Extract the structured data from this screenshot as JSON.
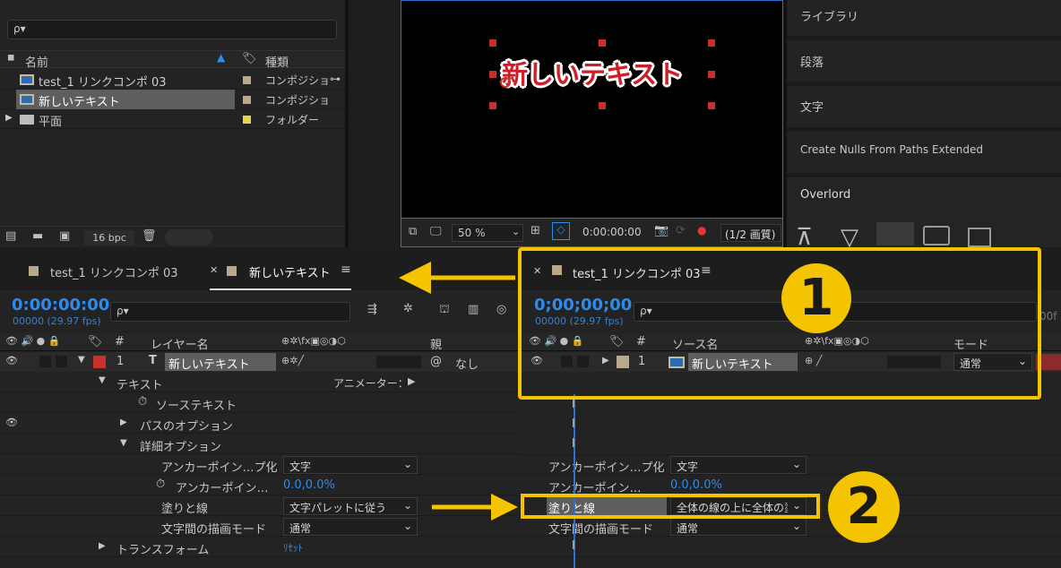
{
  "project": {
    "search_placeholder": "ρ▾",
    "col_name": "名前",
    "col_type": "種類",
    "items": [
      {
        "name": "test_1 リンクコンポ 03",
        "type": "コンポジショ",
        "label_color": "#b9a88a"
      },
      {
        "name": "新しいテキスト",
        "type": "コンポジショ",
        "label_color": "#b9a88a"
      },
      {
        "name": "平面",
        "type": "フォルダー",
        "label_color": "#e6d551"
      }
    ],
    "bpc": "16 bpc"
  },
  "viewer": {
    "text": "新しいテキスト",
    "zoom": "50 %",
    "timecode": "0:00:00:00",
    "resolution": "(1/2 画質)"
  },
  "right_panels": [
    "ライブラリ",
    "段落",
    "文字",
    "Create Nulls From Paths Extended",
    "Overlord"
  ],
  "left_timeline": {
    "tab_inactive": "test_1 リンクコンポ 03",
    "tab_active": "新しいテキスト",
    "timecode": "0:00:00:00",
    "fps": "00000 (29.97 fps)",
    "col_layer_name": "レイヤー名",
    "col_parent": "親",
    "col_switch_icons": "⊕✲\\fx▣◎◑⬡",
    "layer_num": "1",
    "layer_type": "T",
    "layer_name": "新しいテキスト",
    "parent_value": "なし",
    "tree": {
      "text": "テキスト",
      "animator": "アニメーター：",
      "source_text": "ソーステキスト",
      "path_options": "パスのオプション",
      "more_options": "詳細オプション",
      "anchor_group": "アンカーポイン…プ化",
      "anchor_group_value": "文字",
      "anchor_align": "アンカーポイン…",
      "anchor_align_value": "0.0,0.0%",
      "fill_stroke": "塗りと線",
      "fill_stroke_value": "文字パレットに従う",
      "blend": "文字間の描画モード",
      "blend_value": "通常",
      "transform": "トランスフォーム",
      "reset": "ﾘｾｯﾄ"
    }
  },
  "right_timeline": {
    "tab": "test_1 リンクコンポ 03",
    "timecode": "0;00;00;00",
    "fps": "00000 (29.97 fps)",
    "col_source": "ソース名",
    "col_mode": "モード",
    "layer_num": "1",
    "layer_name": "新しいテキスト",
    "mode_value": "通常",
    "anchor_group": "アンカーポイン…プ化",
    "anchor_group_value": "文字",
    "anchor_align": "アンカーポイン…",
    "anchor_align_value": "0.0,0.0%",
    "fill_stroke": "塗りと線",
    "fill_stroke_value": "全体の線の上に全体の塗り",
    "blend": "文字間の描画モード",
    "blend_value": "通常",
    "ruler_tail": "00f"
  },
  "callouts": {
    "one": "1",
    "two": "2"
  },
  "colors": {
    "accent_yellow": "#f5c400",
    "blue": "#2d8ceb",
    "label_red": "#c8302e"
  }
}
